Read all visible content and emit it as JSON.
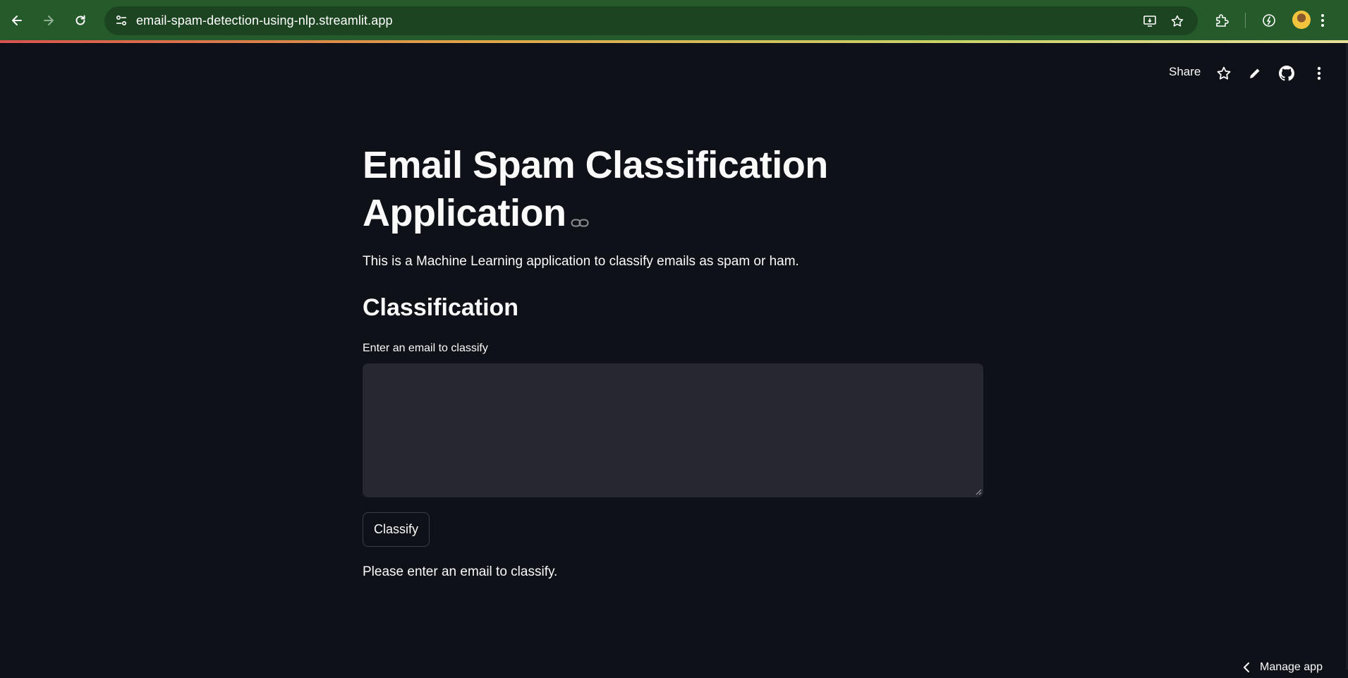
{
  "browser": {
    "url": "email-spam-detection-using-nlp.streamlit.app",
    "icons": {
      "back": "arrow-left-icon",
      "forward": "arrow-right-icon",
      "reload": "reload-icon",
      "site_info": "tune-icon",
      "install": "install-app-icon",
      "bookmark": "star-icon",
      "extensions": "puzzle-icon",
      "performance": "speedometer-icon",
      "profile": "avatar"
    }
  },
  "header": {
    "share_label": "Share",
    "icons": [
      "star-icon",
      "pencil-icon",
      "github-icon",
      "kebab-menu-icon"
    ]
  },
  "main": {
    "title": "Email Spam Classification Application",
    "description": "This is a Machine Learning application to classify emails as spam or ham.",
    "subheading": "Classification",
    "input_label": "Enter an email to classify",
    "input_value": "",
    "button_label": "Classify",
    "status_message": "Please enter an email to classify."
  },
  "footer": {
    "manage_app_label": "Manage app"
  },
  "colors": {
    "background": "#0e1117",
    "chrome": "#255a2b",
    "input_bg": "#262730",
    "text": "#fafafa"
  }
}
